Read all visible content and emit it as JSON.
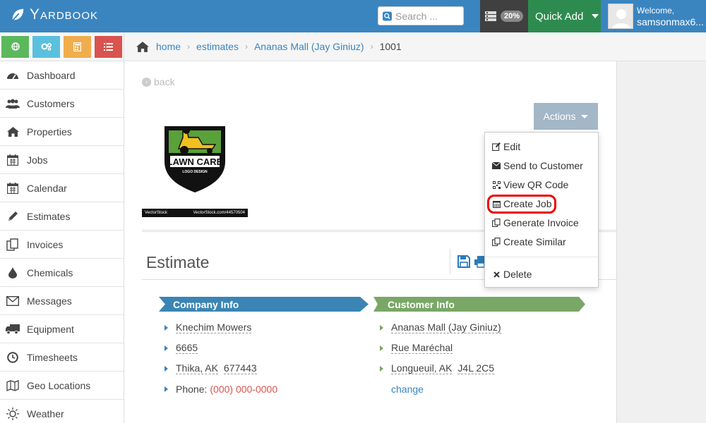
{
  "app": {
    "logo_text": "Yardbook"
  },
  "topbar": {
    "search_placeholder": "Search ...",
    "storage_badge": "20%",
    "quick_add_label": "Quick Add",
    "user_welcome": "Welcome,",
    "user_name": "samsonmax6..."
  },
  "sidebar": {
    "quick_buttons": [
      {
        "icon": "globe-icon",
        "color": "#5cb85c"
      },
      {
        "icon": "gears-icon",
        "color": "#5bc0de"
      },
      {
        "icon": "calculator-icon",
        "color": "#f0ad4e"
      },
      {
        "icon": "list-icon",
        "color": "#d9534f"
      }
    ],
    "items": [
      {
        "label": "Dashboard",
        "icon": "dashboard-icon"
      },
      {
        "label": "Customers",
        "icon": "users-icon"
      },
      {
        "label": "Properties",
        "icon": "home-icon"
      },
      {
        "label": "Jobs",
        "icon": "calendar-icon"
      },
      {
        "label": "Calendar",
        "icon": "calendar-icon"
      },
      {
        "label": "Estimates",
        "icon": "pencil-icon"
      },
      {
        "label": "Invoices",
        "icon": "copy-icon"
      },
      {
        "label": "Chemicals",
        "icon": "drop-icon"
      },
      {
        "label": "Messages",
        "icon": "envelope-icon"
      },
      {
        "label": "Equipment",
        "icon": "truck-icon"
      },
      {
        "label": "Timesheets",
        "icon": "clock-icon"
      },
      {
        "label": "Geo Locations",
        "icon": "map-icon"
      },
      {
        "label": "Weather",
        "icon": "sun-icon"
      }
    ]
  },
  "breadcrumb": {
    "items": [
      "home",
      "estimates",
      "Ananas Mall (Jay Giniuz)"
    ],
    "current": "1001"
  },
  "main": {
    "back_label": "back",
    "actions_label": "Actions",
    "logo_main_text": "LAWN CARE",
    "logo_sub_text": "LOGO DESIGN",
    "watermark_left": "VectorStock",
    "watermark_right": "VectorStock.com/44570504",
    "estimate_title": "Estimate",
    "company_header": "Company Info",
    "customer_header": "Customer Info",
    "company": {
      "name": "Knechim Mowers",
      "street": "6665",
      "city_state": "Thika, AK",
      "zip": "677443",
      "phone_label": "Phone:",
      "phone": "(000) 000-0000"
    },
    "customer": {
      "name": "Ananas Mall (Jay Giniuz)",
      "street": "Rue Maréchal",
      "city_state": "Longueuil, AK",
      "zip": "J4L 2C5",
      "change_label": "change"
    }
  },
  "dropdown": {
    "items": [
      {
        "label": "Edit",
        "icon": "edit-icon"
      },
      {
        "label": "Send to Customer",
        "icon": "envelope-icon"
      },
      {
        "label": "View QR Code",
        "icon": "qrcode-icon"
      },
      {
        "label": "Create Job",
        "icon": "calendar-icon"
      },
      {
        "label": "Generate Invoice",
        "icon": "copy-icon"
      },
      {
        "label": "Create Similar",
        "icon": "copy-icon"
      }
    ],
    "delete_label": "Delete",
    "highlighted": "Create Job"
  },
  "colors": {
    "brand_blue": "#3a85c0",
    "quick_add_green": "#2e8b4f",
    "company_ribbon": "#3a85b4",
    "customer_ribbon": "#79a766",
    "highlight_red": "#ee0000"
  }
}
